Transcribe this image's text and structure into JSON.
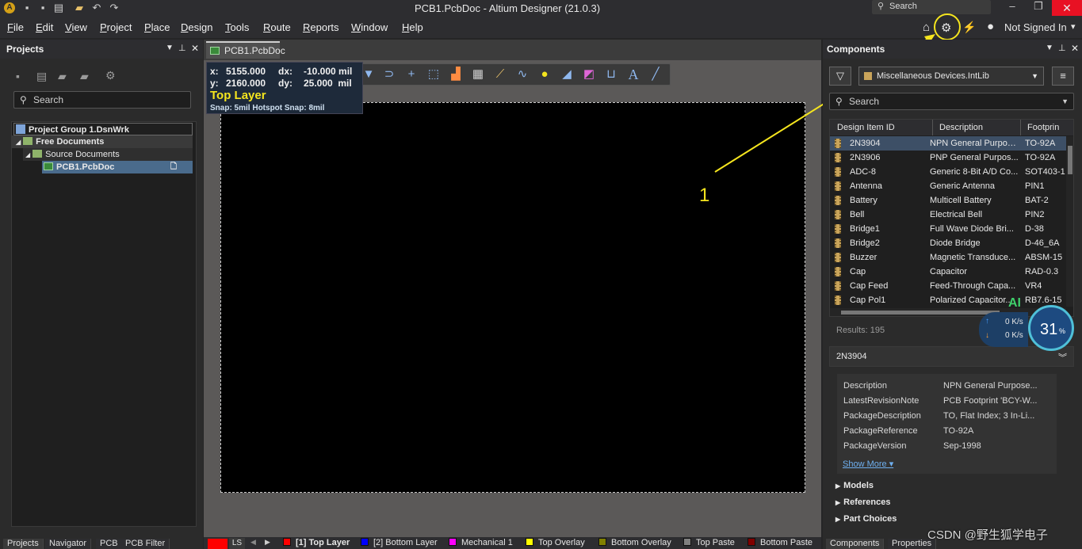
{
  "window": {
    "title": "PCB1.PcbDoc - Altium Designer (21.0.3)",
    "search_placeholder": "Search"
  },
  "menu": [
    "File",
    "Edit",
    "View",
    "Project",
    "Place",
    "Design",
    "Tools",
    "Route",
    "Reports",
    "Window",
    "Help"
  ],
  "account": {
    "label": "Not Signed In",
    "chevron": "▾"
  },
  "projects_panel": {
    "title": "Projects",
    "search_placeholder": "Search",
    "tree": {
      "group": "Project Group 1.DsnWrk",
      "free_docs": "Free Documents",
      "source_docs": "Source Documents",
      "file": "PCB1.PcbDoc"
    }
  },
  "doc_tab": {
    "label": "PCB1.PcbDoc"
  },
  "hud": {
    "x_label": "x:",
    "x_val": "5155.000",
    "dx_label": "dx:",
    "dx_val": "-10.000 mil",
    "y_label": "y:",
    "y_val": "2160.000",
    "dy_label": "dy:",
    "dy_val": "25.000  mil",
    "layer": "Top Layer",
    "snap": "Snap: 5mil Hotspot Snap: 8mil"
  },
  "annotation": {
    "number": "1",
    "color": "#f5e51e"
  },
  "components_panel": {
    "title": "Components",
    "library": "Miscellaneous Devices.IntLib",
    "search_placeholder": "Search",
    "columns": [
      "Design Item ID",
      "Description",
      "Footprin"
    ],
    "rows": [
      {
        "id": "2N3904",
        "desc": "NPN General Purpos...",
        "fp": "TO-92A"
      },
      {
        "id": "2N3906",
        "desc": "PNP General Purpos...",
        "fp": "TO-92A"
      },
      {
        "id": "ADC-8",
        "desc": "Generic 8-Bit A/D Co...",
        "fp": "SOT403-1"
      },
      {
        "id": "Antenna",
        "desc": "Generic Antenna",
        "fp": "PIN1"
      },
      {
        "id": "Battery",
        "desc": "Multicell Battery",
        "fp": "BAT-2"
      },
      {
        "id": "Bell",
        "desc": "Electrical Bell",
        "fp": "PIN2"
      },
      {
        "id": "Bridge1",
        "desc": "Full Wave Diode Bri...",
        "fp": "D-38"
      },
      {
        "id": "Bridge2",
        "desc": "Diode Bridge",
        "fp": "D-46_6A"
      },
      {
        "id": "Buzzer",
        "desc": "Magnetic Transduce...",
        "fp": "ABSM-15"
      },
      {
        "id": "Cap",
        "desc": "Capacitor",
        "fp": "RAD-0.3"
      },
      {
        "id": "Cap Feed",
        "desc": "Feed-Through Capa...",
        "fp": "VR4"
      },
      {
        "id": "Cap Pol1",
        "desc": "Polarized Capacitor...",
        "fp": "RB7.6-15"
      }
    ],
    "results": "Results: 195",
    "selected": "2N3904",
    "properties": [
      {
        "k": "Description",
        "v": "NPN General Purpose..."
      },
      {
        "k": "LatestRevisionNote",
        "v": "PCB Footprint 'BCY-W..."
      },
      {
        "k": "PackageDescription",
        "v": "TO, Flat Index; 3 In-Li..."
      },
      {
        "k": "PackageReference",
        "v": "TO-92A"
      },
      {
        "k": "PackageVersion",
        "v": "Sep-1998"
      }
    ],
    "show_more": "Show More ▾",
    "sections": [
      "Models",
      "References",
      "Part Choices"
    ]
  },
  "net_widget": {
    "up": "0 K/s",
    "down": "0 K/s",
    "percent": "31",
    "percent_sign": "%",
    "badge": "AI"
  },
  "bottom_left_tabs": [
    "Projects",
    "Navigator",
    "PCB",
    "PCB Filter"
  ],
  "layer_tabs": [
    {
      "label": "[1] Top Layer",
      "color": "#ff0000"
    },
    {
      "label": "[2] Bottom Layer",
      "color": "#0000ff"
    },
    {
      "label": "Mechanical 1",
      "color": "#ff00ff"
    },
    {
      "label": "Top Overlay",
      "color": "#ffff00"
    },
    {
      "label": "Bottom Overlay",
      "color": "#808000"
    },
    {
      "label": "Top Paste",
      "color": "#808080"
    },
    {
      "label": "Bottom Paste",
      "color": "#800000"
    }
  ],
  "ls_label": "LS",
  "right_bottom_tabs": [
    "Components",
    "Properties"
  ],
  "watermark": "CSDN @野生狐学电子"
}
